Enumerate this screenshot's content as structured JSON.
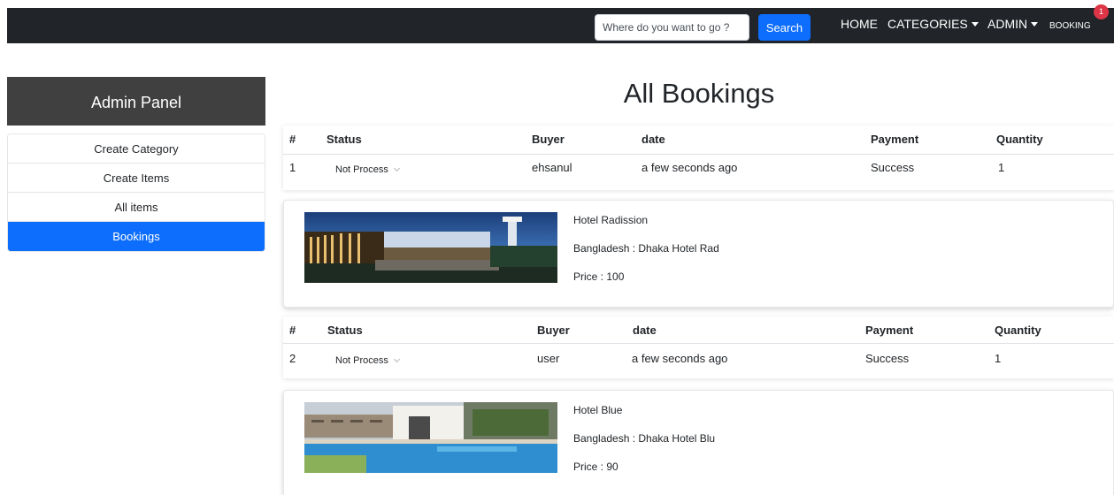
{
  "navbar": {
    "search_placeholder": "Where do you want to go ?",
    "search_button": "Search",
    "links": {
      "home": "HOME",
      "categories": "CATEGORIES",
      "admin": "ADMIN",
      "booking": "BOOKING"
    },
    "booking_badge": "1"
  },
  "sidebar": {
    "title": "Admin Panel",
    "items": [
      {
        "label": "Create Category"
      },
      {
        "label": "Create Items"
      },
      {
        "label": "All items"
      },
      {
        "label": "Bookings",
        "active": true
      }
    ]
  },
  "main": {
    "title": "All Bookings",
    "columns": [
      "#",
      "Status",
      "Buyer",
      "date",
      "Payment",
      "Quantity"
    ],
    "bookings": [
      {
        "index": "1",
        "status": "Not Process",
        "buyer": "ehsanul",
        "date": "a few seconds ago",
        "payment": "Success",
        "quantity": "1",
        "item": {
          "name": "Hotel Radission",
          "location": "Bangladesh : Dhaka Hotel Rad",
          "price": "Price : 100"
        }
      },
      {
        "index": "2",
        "status": "Not Process",
        "buyer": "user",
        "date": "a few seconds ago",
        "payment": "Success",
        "quantity": "1",
        "item": {
          "name": "Hotel Blue",
          "location": "Bangladesh : Dhaka Hotel Blu",
          "price": "Price : 90"
        }
      }
    ]
  },
  "colors": {
    "navbar": "#212529",
    "primary": "#0d6efd",
    "admin_header": "#404040",
    "badge": "#dc3545"
  }
}
